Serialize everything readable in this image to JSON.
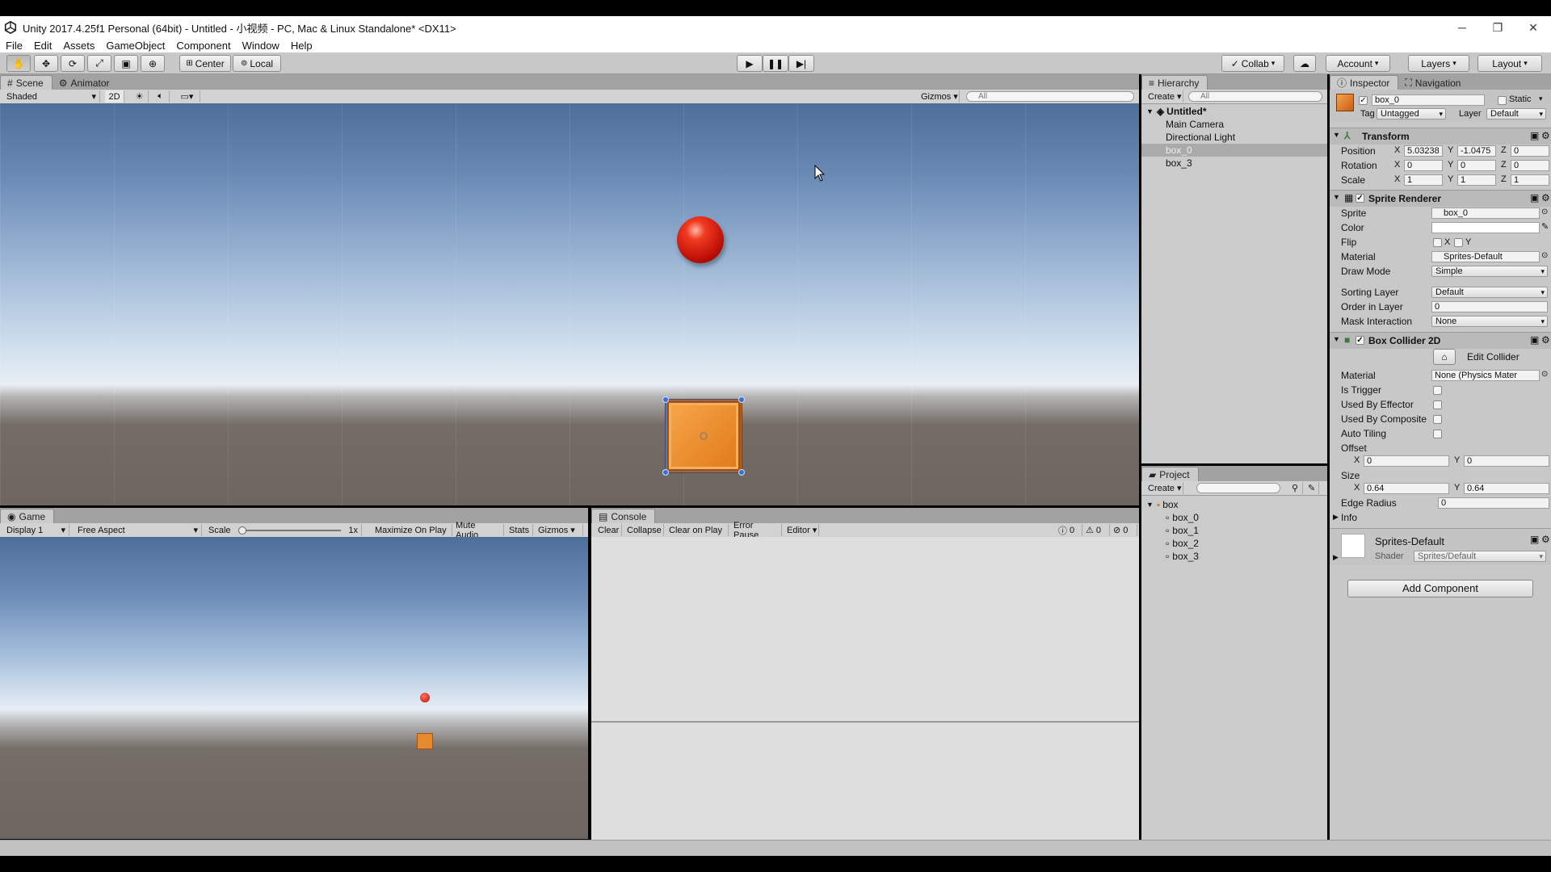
{
  "window": {
    "title": "Unity 2017.4.25f1 Personal (64bit) - Untitled - 小视频 - PC, Mac & Linux Standalone* <DX11>",
    "minimize": "─",
    "maximize": "❐",
    "close": "✕"
  },
  "menu": [
    "File",
    "Edit",
    "Assets",
    "GameObject",
    "Component",
    "Window",
    "Help"
  ],
  "toolbar": {
    "pivot": "Center",
    "space": "Local",
    "collab": "Collab",
    "account": "Account",
    "layers": "Layers",
    "layout": "Layout"
  },
  "scene": {
    "tabs": [
      "Scene",
      "Animator"
    ],
    "shading": "Shaded",
    "mode2d": "2D",
    "gizmos": "Gizmos",
    "search_placeholder": "All"
  },
  "game": {
    "tab": "Game",
    "display": "Display 1",
    "aspect": "Free Aspect",
    "scale_label": "Scale",
    "scale_value": "1x",
    "maximize": "Maximize On Play",
    "mute": "Mute Audio",
    "stats": "Stats",
    "gizmos": "Gizmos"
  },
  "console": {
    "tab": "Console",
    "clear": "Clear",
    "collapse": "Collapse",
    "clear_on_play": "Clear on Play",
    "error_pause": "Error Pause",
    "editor": "Editor",
    "info_count": "0",
    "warn_count": "0",
    "error_count": "0"
  },
  "hierarchy": {
    "tab": "Hierarchy",
    "create": "Create",
    "search_placeholder": "All",
    "scene_name": "Untitled*",
    "items": [
      "Main Camera",
      "Directional Light",
      "box_0",
      "box_3"
    ],
    "selected_index": 2
  },
  "project": {
    "tab": "Project",
    "create": "Create",
    "folder": "box",
    "items": [
      "box_0",
      "box_1",
      "box_2",
      "box_3"
    ]
  },
  "inspector": {
    "tabs": [
      "Inspector",
      "Navigation"
    ],
    "object_name": "box_0",
    "static_label": "Static",
    "tag_label": "Tag",
    "tag": "Untagged",
    "layer_label": "Layer",
    "layer": "Default",
    "transform": {
      "title": "Transform",
      "position_label": "Position",
      "rotation_label": "Rotation",
      "scale_label": "Scale",
      "position": [
        "5.03238",
        "-1.0475",
        "0"
      ],
      "rotation": [
        "0",
        "0",
        "0"
      ],
      "scale": [
        "1",
        "1",
        "1"
      ]
    },
    "sprite_renderer": {
      "title": "Sprite Renderer",
      "sprite_label": "Sprite",
      "sprite": "box_0",
      "color_label": "Color",
      "flip_label": "Flip",
      "flip_x": "X",
      "flip_y": "Y",
      "material_label": "Material",
      "material": "Sprites-Default",
      "draw_mode_label": "Draw Mode",
      "draw_mode": "Simple",
      "sorting_layer_label": "Sorting Layer",
      "sorting_layer": "Default",
      "order_label": "Order in Layer",
      "order": "0",
      "mask_label": "Mask Interaction",
      "mask": "None"
    },
    "box_collider": {
      "title": "Box Collider 2D",
      "edit_collider": "Edit Collider",
      "material_label": "Material",
      "material": "None (Physics Mater",
      "is_trigger": "Is Trigger",
      "used_by_effector": "Used By Effector",
      "used_by_composite": "Used By Composite",
      "auto_tiling": "Auto Tiling",
      "offset_label": "Offset",
      "offset": [
        "0",
        "0"
      ],
      "size_label": "Size",
      "size": [
        "0.64",
        "0.64"
      ],
      "edge_radius_label": "Edge Radius",
      "edge_radius": "0",
      "info_label": "Info"
    },
    "material_block": {
      "name": "Sprites-Default",
      "shader_label": "Shader",
      "shader": "Sprites/Default"
    },
    "add_component": "Add Component"
  },
  "axis_labels": {
    "x": "X",
    "y": "Y",
    "z": "Z"
  },
  "colors": {
    "ball": "#d8170e",
    "box": "#e58a2d",
    "panel": "#c2c2c2",
    "selection": "#aaaaaa"
  }
}
